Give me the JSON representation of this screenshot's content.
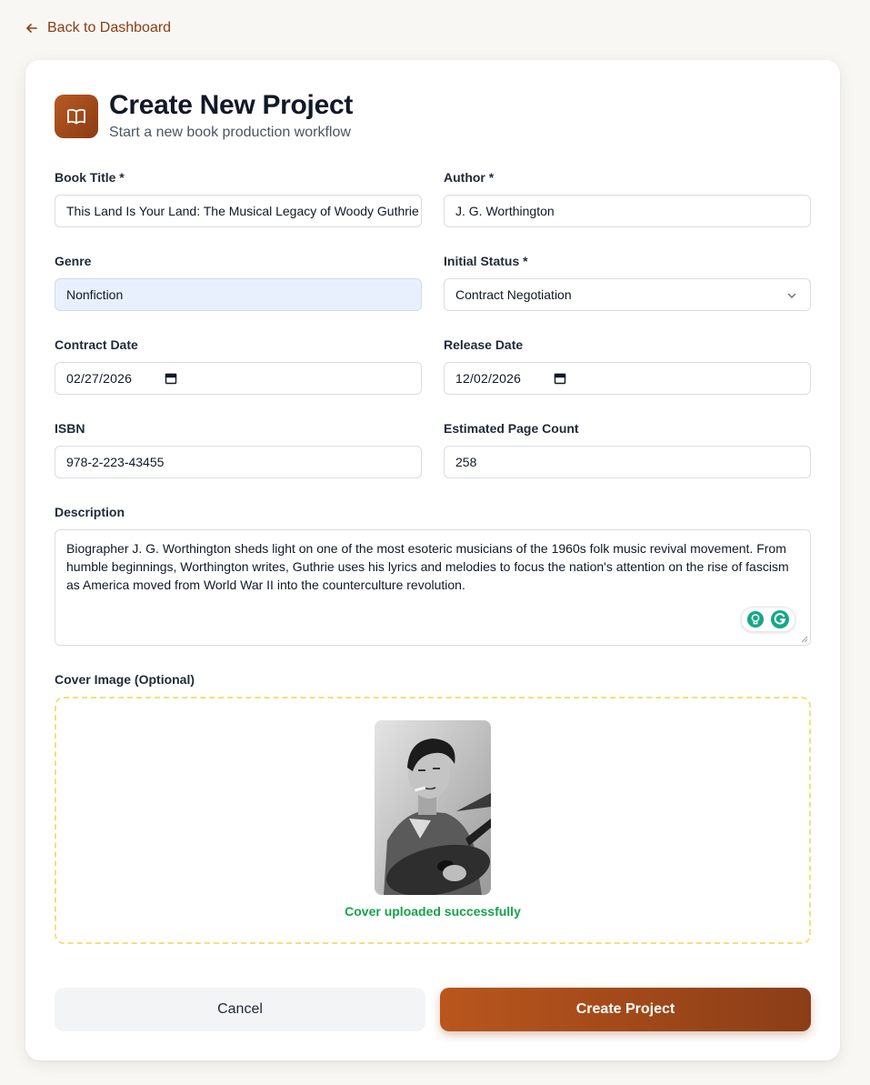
{
  "nav": {
    "back_label": "Back to Dashboard"
  },
  "header": {
    "title": "Create New Project",
    "subtitle": "Start a new book production workflow",
    "icon": "open-book-icon"
  },
  "form": {
    "book_title": {
      "label": "Book Title *",
      "value": "This Land Is Your Land: The Musical Legacy of Woody Guthrie"
    },
    "author": {
      "label": "Author *",
      "value": "J. G. Worthington"
    },
    "genre": {
      "label": "Genre",
      "value": "Nonfiction"
    },
    "initial_status": {
      "label": "Initial Status *",
      "value": "Contract Negotiation"
    },
    "contract_date": {
      "label": "Contract Date",
      "value": "02/27/2026"
    },
    "release_date": {
      "label": "Release Date",
      "value": "12/02/2026"
    },
    "isbn": {
      "label": "ISBN",
      "value": "978-2-223-43455"
    },
    "page_count": {
      "label": "Estimated Page Count",
      "value": "258"
    },
    "description": {
      "label": "Description",
      "value": "Biographer J. G. Worthington sheds light on one of the most esoteric musicians of the 1960s folk music revival movement. From humble beginnings, Worthington writes, Guthrie uses his lyrics and melodies to focus the nation's attention on the rise of fascism as America moved from World War II into the counterculture revolution."
    },
    "cover": {
      "label": "Cover Image (Optional)",
      "status": "Cover uploaded successfully"
    }
  },
  "actions": {
    "cancel_label": "Cancel",
    "create_label": "Create Project"
  },
  "colors": {
    "accent": "#8b3d12",
    "accent_gradient_start": "#b9561d",
    "success": "#16a34a",
    "upload_border": "#f6de7a",
    "autofill_bg": "#e8f0fe"
  }
}
